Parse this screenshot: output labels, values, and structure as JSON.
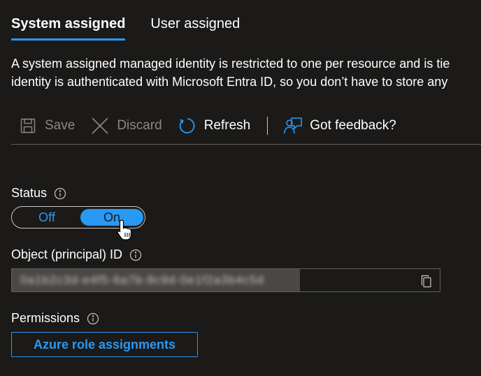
{
  "tabs": [
    {
      "label": "System assigned",
      "active": true
    },
    {
      "label": "User assigned",
      "active": false
    }
  ],
  "description": {
    "line1": "A system assigned managed identity is restricted to one per resource and is tie",
    "line2": "identity is authenticated with Microsoft Entra ID, so you don’t have to store any"
  },
  "toolbar": {
    "save_label": "Save",
    "save_icon": "save-icon",
    "discard_label": "Discard",
    "discard_icon": "close-icon",
    "refresh_label": "Refresh",
    "refresh_icon": "refresh-icon",
    "feedback_label": "Got feedback?",
    "feedback_icon": "feedback-icon"
  },
  "status": {
    "label": "Status",
    "off_label": "Off",
    "on_label": "On",
    "selected": "On"
  },
  "object_id": {
    "label": "Object (principal) ID",
    "value": "0a1b2c3d-e4f5-6a7b-8c9d-0e1f2a3b4c5d",
    "redacted": true
  },
  "permissions": {
    "label": "Permissions",
    "button_label": "Azure role assignments"
  },
  "colors": {
    "background": "#1b1a19",
    "accent": "#2899f5",
    "disabled_text": "#8a8886",
    "divider": "#605e5c"
  }
}
